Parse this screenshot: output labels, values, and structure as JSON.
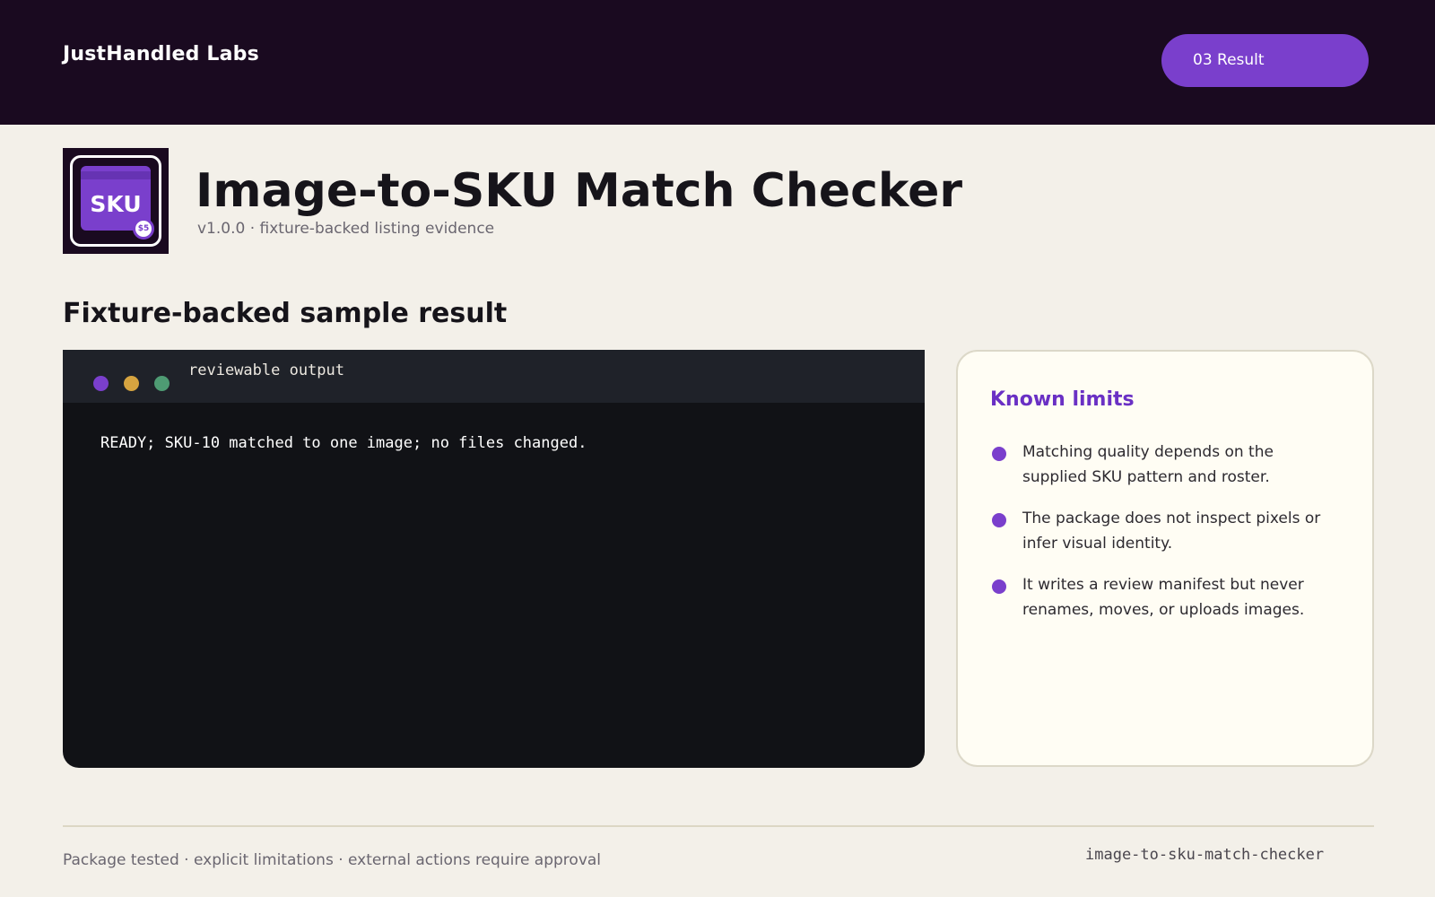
{
  "header": {
    "brand": "JustHandled Labs",
    "step_label": "03 Result"
  },
  "app": {
    "icon_text": "SKU",
    "icon_badge": "$5",
    "title": "Image-to-SKU Match Checker",
    "subtitle": "v1.0.0 · fixture-backed listing evidence"
  },
  "main": {
    "section_heading": "Fixture-backed sample result",
    "terminal": {
      "label": "reviewable output",
      "output": "READY; SKU-10 matched to one image; no files changed."
    },
    "limits": {
      "title": "Known limits",
      "items": [
        "Matching quality depends on the supplied SKU pattern and roster.",
        "The package does not inspect pixels or infer visual identity.",
        "It writes a review manifest but never renames, moves, or uploads images."
      ]
    }
  },
  "footer": {
    "left_text": "Package tested · explicit limitations · external actions require approval",
    "package_name": "image-to-sku-match-checker"
  },
  "colors": {
    "header_bg": "#1a0a20",
    "accent_purple": "#7a3fcc",
    "page_bg": "#f3f0e9",
    "terminal_bg": "#111216",
    "dot_yellow": "#d6a440",
    "dot_green": "#4e9b73"
  },
  "icons": {
    "app_icon": "sku-tag-icon",
    "window_controls": [
      "purple-dot-icon",
      "yellow-dot-icon",
      "green-dot-icon"
    ],
    "list_bullet": "bullet-dot-icon"
  }
}
